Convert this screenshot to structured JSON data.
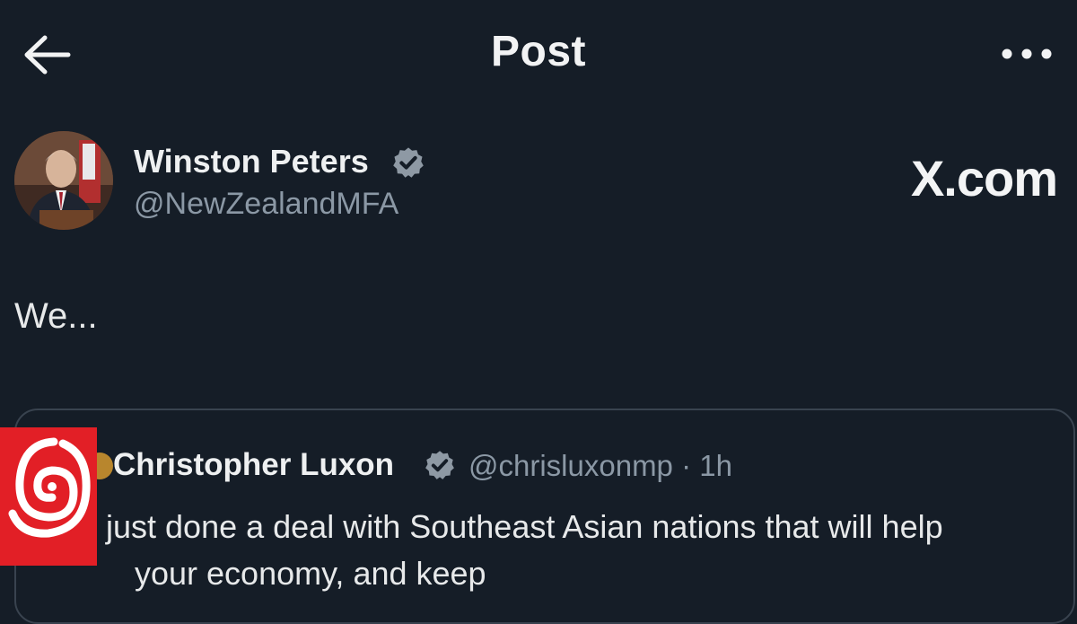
{
  "header": {
    "title": "Post",
    "back_icon": "arrow-left-icon",
    "more_icon": "more-horizontal-icon"
  },
  "post": {
    "author_name": "Winston Peters",
    "author_handle": "@NewZealandMFA",
    "verified_icon": "verified-badge-icon",
    "text": "We..."
  },
  "site_label": "X.com",
  "quoted_post": {
    "author_name": "Christopher Luxon",
    "author_handle": "@chrisluxonmp",
    "time": "· 1h",
    "text_line1": "just done a deal with Southeast Asian nations that will help",
    "text_line2": "your economy, and keep"
  },
  "colors": {
    "background": "#151d27",
    "text": "#e7e9ea",
    "muted": "#8b98a5",
    "border": "#39434f",
    "badge_red": "#e21f26"
  }
}
